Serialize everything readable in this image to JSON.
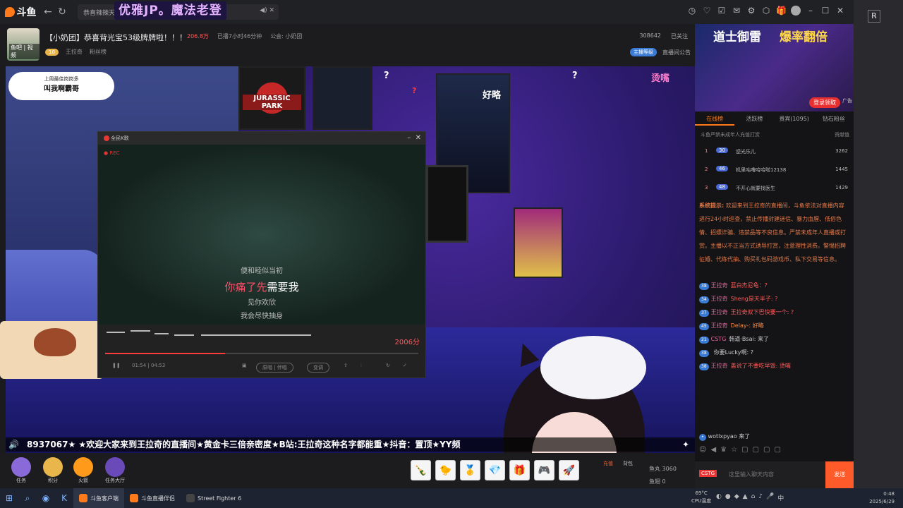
{
  "topbar": {
    "logo": "斗鱼",
    "tab_banner": "优雅JP。魔法老登",
    "tab_title": "恭喜辣辣天",
    "r_badge": "R"
  },
  "room": {
    "title": "【小奶团】恭喜背光宝53级牌牌啦！！！",
    "hot": "206.8万",
    "live_time": "已播7小时46分钟",
    "guild": "公会: 小奶团",
    "streamer": "王拉奇",
    "level": "10",
    "fans_label": "粉丝榜",
    "avatar_label": "鱼吧 | 视频",
    "room_id": "308642",
    "follow": "已关注",
    "tag": "直播间公告",
    "badge": "主播等级"
  },
  "video": {
    "sticker_line1": "上周最佳岗岗多",
    "sticker_line2": "叫我啊霸哥",
    "poster_jp": "JURASSIC PARK",
    "overlay_q1": "?",
    "overlay_q2": "?",
    "overlay_hao": "好略",
    "overlay_tang": "烫嘴",
    "overlay_q3": "?",
    "ticker": "8937067★ ★欢迎大家来到王拉奇的直播间★黄金卡三倍亲密度★B站:王拉奇这种名字都能重★抖音：置顶★YY频",
    "ticker_speaker": "🔊",
    "ticker_star": "✦"
  },
  "karaoke": {
    "title": "全民K歌",
    "rec": "● REC",
    "lyric1": "便和睦似当初",
    "lyric2_sung": "你痛了先",
    "lyric2_rest": "需要我",
    "lyric3": "见你欢欣",
    "lyric4": "我会尽快抽身",
    "score": "2006分",
    "time": "01:54 | 04:53",
    "pill1": "原唱 | 伴唱",
    "pill2": "变调"
  },
  "giftbar": {
    "items": [
      "任务",
      "积分",
      "火箭",
      "任务大厅"
    ],
    "gifts": [
      "🍾",
      "🐤",
      "🥇",
      "💎",
      "🎁",
      "🎮",
      "🚀"
    ],
    "charge": "充值",
    "backpack": "背包",
    "count1_label": "鱼丸",
    "count1": "3060",
    "count2_label": "鱼翅",
    "count2": "0"
  },
  "sidebar": {
    "ad_t1": "道士御雷",
    "ad_t2": "爆率翻倍",
    "ad_cta": "登录领取",
    "ad_label": "广告",
    "tabs": [
      "在线榜",
      "活跃榜",
      "贵宾(1095)",
      "钻石粉丝"
    ],
    "rank_note": "斗鱼严禁未成年人充值打赏",
    "rank_note2": "贡献值",
    "ranks": [
      {
        "no": "1",
        "badge": "30",
        "name": "逆光乐儿",
        "val": "3262"
      },
      {
        "no": "2",
        "badge": "46",
        "name": "机里咕噜哈哈啦12138",
        "val": "1445"
      },
      {
        "no": "3",
        "badge": "48",
        "name": "不开心就要找医生",
        "val": "1429"
      }
    ],
    "sys_label": "系统提示:",
    "sys_text": "欢迎来到王拉奇的直播间，斗鱼依法对直播内容进行24小时巡查，禁止传播封建迷信、暴力血腥、低俗色情、招嫖诈骗、违禁品等不良信息。严禁未成年人直播或打赏。主播以不正当方式诱导打赏，注意理性消费。警惕招聘征婚、代练代抽、购买礼包码游戏币、私下交易等信息。",
    "chats": [
      {
        "lv": "38",
        "name": "王拉奇",
        "msg": "蓝白杰尼龟：?",
        "cls": "msg-r"
      },
      {
        "lv": "34",
        "name": "王拉奇",
        "msg": "Sheng是天半子: ?",
        "cls": "msg-r"
      },
      {
        "lv": "37",
        "name": "王拉奇",
        "msg": "王拉奇双下巴快要一个: ?",
        "cls": "msg-r"
      },
      {
        "lv": "45",
        "name": "王拉奇",
        "msg": "Delay-: 好略",
        "cls": "msg-o"
      },
      {
        "lv": "21",
        "name": "CSTG",
        "msg": "韩道·Bsai: 来了",
        "cls": "msg-w"
      },
      {
        "lv": "38",
        "name": "",
        "msg": "你要Lucky啊: ?",
        "cls": "msg-w"
      },
      {
        "lv": "38",
        "name": "王拉奇",
        "msg": "盖说了不要吃早饭: 烫嘴",
        "cls": "msg-r"
      }
    ],
    "enter_msg": "wotlxpyao 来了",
    "input_placeholder": "这里输入聊天内容",
    "send": "发送",
    "csgo": "CSTG"
  },
  "taskbar": {
    "apps": [
      "斗鱼客户端",
      "斗鱼直播伴侣",
      "Street Fighter 6"
    ],
    "cpu": "69°C",
    "cpu_label": "CPU温度",
    "time": "0:48",
    "date": "2025/6/29"
  }
}
